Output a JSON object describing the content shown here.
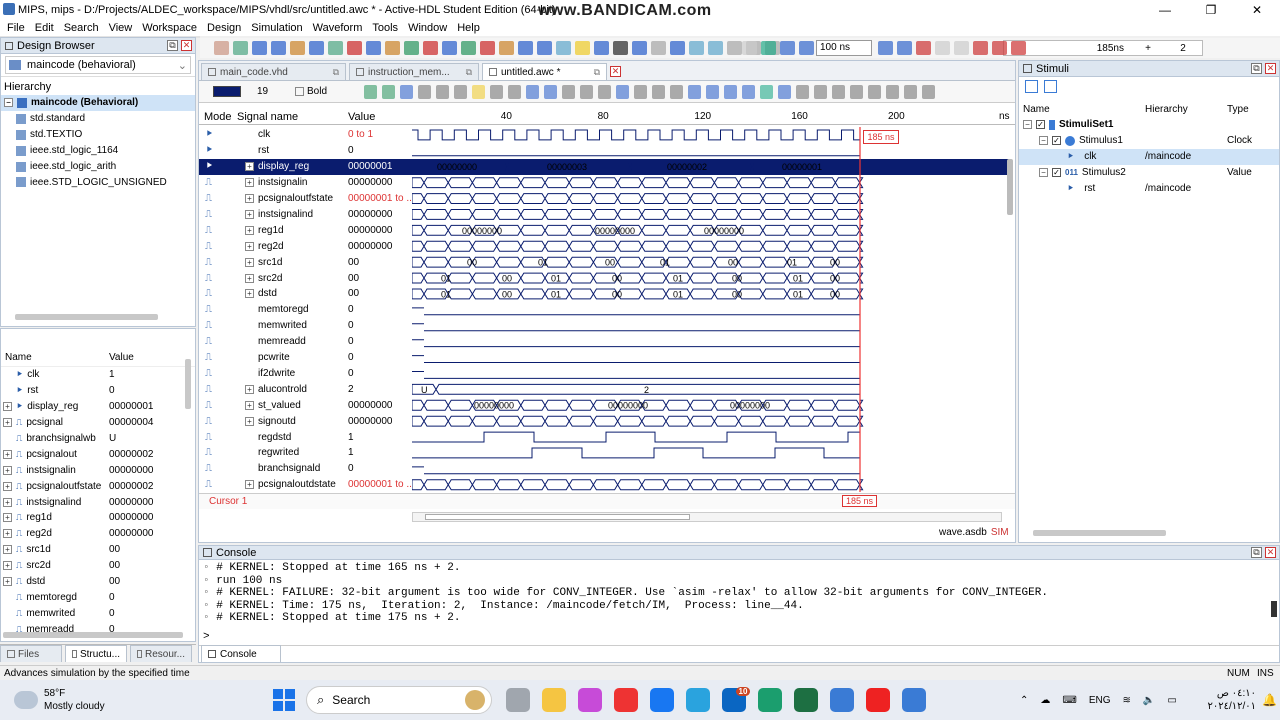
{
  "app": {
    "title": "MIPS, mips - D:/Projects/ALDEC_workspace/MIPS/vhdl/src/untitled.awc * - Active-HDL Student Edition (64-bit)",
    "watermark": "www.BANDICAM.com",
    "menu": [
      "File",
      "Edit",
      "Search",
      "View",
      "Workspace",
      "Design",
      "Simulation",
      "Waveform",
      "Tools",
      "Window",
      "Help"
    ]
  },
  "toolbar": {
    "run_for": "100 ns",
    "time_display": "185ns",
    "plus": "+",
    "delta": "2"
  },
  "design_browser": {
    "title": "Design Browser",
    "unit": "maincode (behavioral)",
    "hierarchy_label": "Hierarchy",
    "items": [
      "maincode (Behavioral)",
      "std.standard",
      "std.TEXTIO",
      "ieee.std_logic_1164",
      "ieee.std_logic_arith",
      "ieee.STD_LOGIC_UNSIGNED"
    ]
  },
  "objects": {
    "headers": [
      "Name",
      "Value"
    ],
    "rows": [
      {
        "name": "clk",
        "value": "1"
      },
      {
        "name": "rst",
        "value": "0"
      },
      {
        "name": "display_reg",
        "value": "00000001"
      },
      {
        "name": "pcsignal",
        "value": "00000004"
      },
      {
        "name": "branchsignalwb",
        "value": "U"
      },
      {
        "name": "pcsignalout",
        "value": "00000002"
      },
      {
        "name": "instsignalin",
        "value": "00000000"
      },
      {
        "name": "pcsignaloutfstate",
        "value": "00000002"
      },
      {
        "name": "instsignalind",
        "value": "00000000"
      },
      {
        "name": "reg1d",
        "value": "00000000"
      },
      {
        "name": "reg2d",
        "value": "00000000"
      },
      {
        "name": "src1d",
        "value": "00"
      },
      {
        "name": "src2d",
        "value": "00"
      },
      {
        "name": "dstd",
        "value": "00"
      },
      {
        "name": "memtoregd",
        "value": "0"
      },
      {
        "name": "memwrited",
        "value": "0"
      },
      {
        "name": "memreadd",
        "value": "0"
      }
    ]
  },
  "left_tabs": [
    "Files",
    "Structu...",
    "Resour..."
  ],
  "editor_tabs": [
    "main_code.vhd",
    "instruction_mem...",
    "untitled.awc *"
  ],
  "format": {
    "font_size": "19",
    "bold_label": "Bold"
  },
  "waveform": {
    "headers": [
      "Mode",
      "Signal name",
      "Value"
    ],
    "ticks": [
      "40",
      "80",
      "120",
      "160",
      "200",
      "ns"
    ],
    "cursor_time": "185 ns",
    "cursor_label": "Cursor 1",
    "cursor_bottom": "185  ns",
    "signals": [
      {
        "name": "clk",
        "value": "0 to 1",
        "red": true,
        "exp": false
      },
      {
        "name": "rst",
        "value": "0",
        "exp": false
      },
      {
        "name": "display_reg",
        "value": "00000001",
        "exp": true,
        "selected": true
      },
      {
        "name": "instsignalin",
        "value": "00000000",
        "exp": true
      },
      {
        "name": "pcsignaloutfstate",
        "value": "00000001 to ...",
        "red": true,
        "exp": true
      },
      {
        "name": "instsignalind",
        "value": "00000000",
        "exp": true
      },
      {
        "name": "reg1d",
        "value": "00000000",
        "exp": true
      },
      {
        "name": "reg2d",
        "value": "00000000",
        "exp": true
      },
      {
        "name": "src1d",
        "value": "00",
        "exp": true
      },
      {
        "name": "src2d",
        "value": "00",
        "exp": true
      },
      {
        "name": "dstd",
        "value": "00",
        "exp": true
      },
      {
        "name": "memtoregd",
        "value": "0",
        "exp": false
      },
      {
        "name": "memwrited",
        "value": "0",
        "exp": false
      },
      {
        "name": "memreadd",
        "value": "0",
        "exp": false
      },
      {
        "name": "pcwrite",
        "value": "0",
        "exp": false
      },
      {
        "name": "if2dwrite",
        "value": "0",
        "exp": false
      },
      {
        "name": "alucontrold",
        "value": "2",
        "exp": true
      },
      {
        "name": "st_valued",
        "value": "00000000",
        "exp": true
      },
      {
        "name": "signoutd",
        "value": "00000000",
        "exp": true
      },
      {
        "name": "regdstd",
        "value": "1",
        "exp": false
      },
      {
        "name": "regwrited",
        "value": "1",
        "exp": false
      },
      {
        "name": "branchsignald",
        "value": "0",
        "exp": false
      },
      {
        "name": "pcsignaloutdstate",
        "value": "00000001 to ...",
        "red": true,
        "exp": true
      }
    ],
    "bus_labels": {
      "display_reg": [
        "00000000",
        "00000003",
        "00000002",
        "00000001"
      ],
      "reg1d": [
        "00000000",
        "00000000",
        "00000000"
      ],
      "src1d": [
        "00",
        "01",
        "00",
        "01",
        "00",
        "01",
        "00"
      ],
      "src2d": [
        "01",
        "00",
        "01",
        "00",
        "01",
        "00",
        "01",
        "00"
      ],
      "dstd": [
        "01",
        "00",
        "01",
        "00",
        "01",
        "00",
        "01",
        "00"
      ],
      "alucontrold": [
        "U",
        "2"
      ],
      "st_valued": [
        "00000000",
        "00000000",
        "00000000"
      ]
    },
    "footer_file": "wave.asdb",
    "footer_mode": "SIM"
  },
  "stimuli": {
    "title": "Stimuli",
    "headers": [
      "Name",
      "Hierarchy",
      "Type"
    ],
    "rows": [
      {
        "name": "StimuliSet1",
        "hier": "",
        "type": ""
      },
      {
        "name": "Stimulus1",
        "hier": "",
        "type": "Clock"
      },
      {
        "name": "clk",
        "hier": "/maincode",
        "type": ""
      },
      {
        "name": "Stimulus2",
        "hier": "",
        "type": "Value"
      },
      {
        "name": "rst",
        "hier": "/maincode",
        "type": ""
      }
    ]
  },
  "console": {
    "title": "Console",
    "lines": [
      "# KERNEL: Stopped at time 165 ns + 2.",
      "run 100 ns",
      "# KERNEL: FAILURE: 32-bit argument is too wide for CONV_INTEGER. Use `asim -relax' to allow 32-bit arguments for CONV_INTEGER.",
      "# KERNEL: Time: 175 ns,  Iteration: 2,  Instance: /maincode/fetch/IM,  Process: line__44.",
      "# KERNEL: Stopped at time 175 ns + 2."
    ],
    "prompt": ">",
    "tab": "Console"
  },
  "statusbar": {
    "hint": "Advances simulation by the specified time",
    "num": "NUM",
    "ins": "INS"
  },
  "taskbar": {
    "weather_temp": "58°F",
    "weather_desc": "Mostly cloudy",
    "search": "Search",
    "lang": "ENG",
    "time": "٠٤:١٠ ص",
    "date": "٢٠٢٤/١٢/٠١",
    "badge": "10"
  }
}
